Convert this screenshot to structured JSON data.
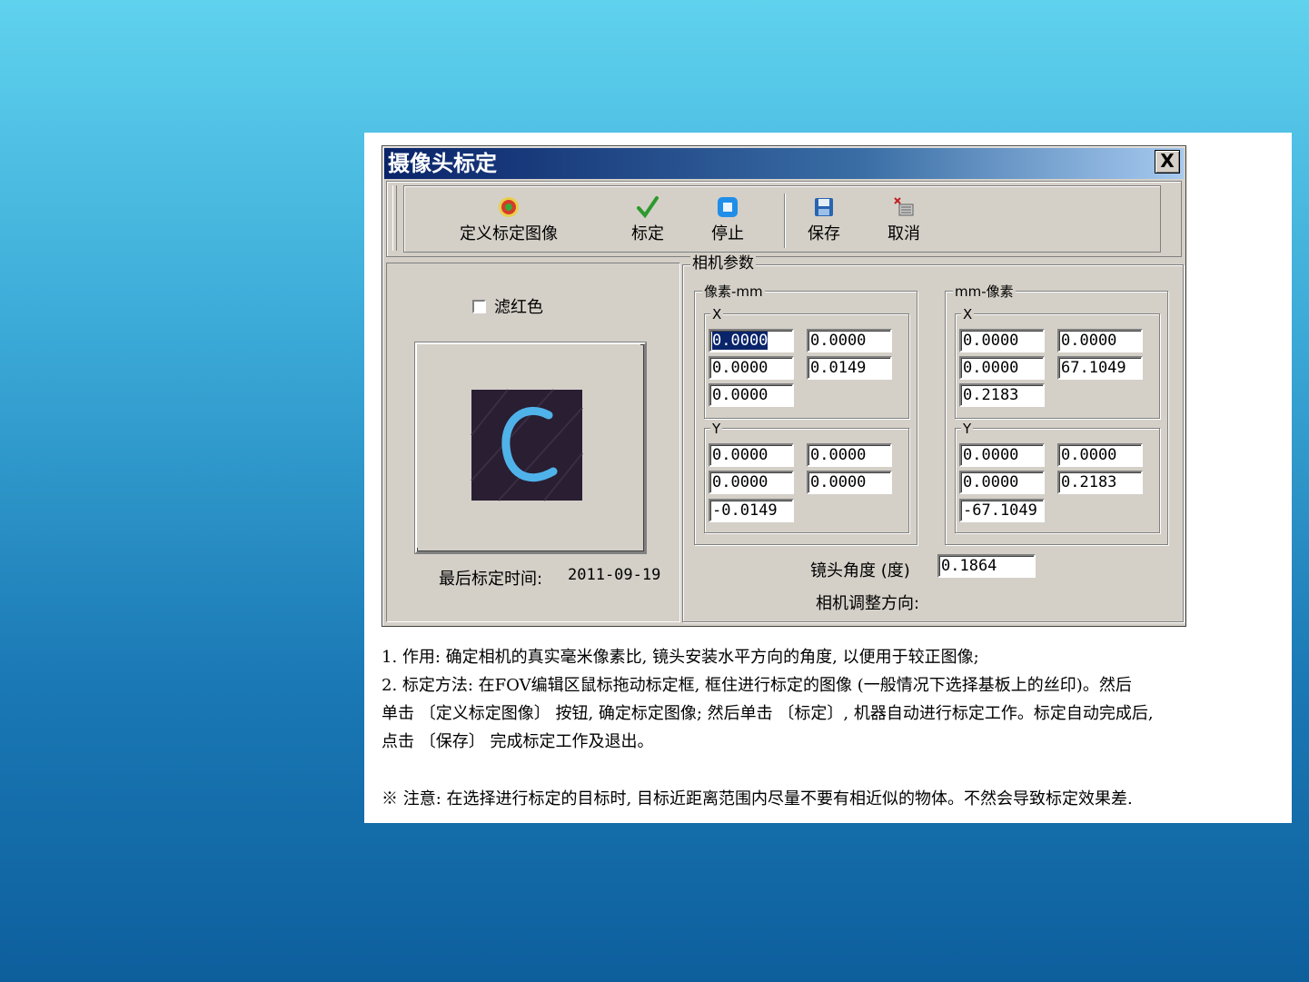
{
  "dialog": {
    "title": "摄像头标定",
    "close_label": "X"
  },
  "toolbar": {
    "define_image": "定义标定图像",
    "calibrate": "标定",
    "stop": "停止",
    "save": "保存",
    "cancel": "取消"
  },
  "left_panel": {
    "filter_red_label": "滤红色",
    "filter_red_checked": false,
    "last_calibration_label": "最后标定时间:",
    "last_calibration_date": "2011-09-19"
  },
  "camera_params": {
    "title": "相机参数",
    "pixel_mm": {
      "title": "像素-mm",
      "x": {
        "label": "X",
        "r1c1": "0.0000",
        "r1c2": "0.0000",
        "r2c1": "0.0000",
        "r2c2": "0.0149",
        "r3c1": "0.0000"
      },
      "y": {
        "label": "Y",
        "r1c1": "0.0000",
        "r1c2": "0.0000",
        "r2c1": "0.0000",
        "r2c2": "0.0000",
        "r3c1": "-0.0149"
      }
    },
    "mm_pixel": {
      "title": "mm-像素",
      "x": {
        "label": "X",
        "r1c1": "0.0000",
        "r1c2": "0.0000",
        "r2c1": "0.0000",
        "r2c2": "67.1049",
        "r3c1": "0.2183"
      },
      "y": {
        "label": "Y",
        "r1c1": "0.0000",
        "r1c2": "0.0000",
        "r2c1": "0.0000",
        "r2c2": "0.2183",
        "r3c1": "-67.1049"
      }
    },
    "lens_angle_label": "镜头角度 (度)",
    "lens_angle_value": "0.1864",
    "adjust_direction_label": "相机调整方向:"
  },
  "description": {
    "line1": "1. 作用: 确定相机的真实毫米像素比, 镜头安装水平方向的角度, 以便用于较正图像;",
    "line2": "2. 标定方法: 在FOV编辑区鼠标拖动标定框, 框住进行标定的图像 (一般情况下选择基板上的丝印)。然后",
    "line3": "单击 〔定义标定图像〕 按钮, 确定标定图像; 然后单击 〔标定〕, 机器自动进行标定工作。标定自动完成后,",
    "line4": "点击 〔保存〕 完成标定工作及退出。",
    "note": "※  注意: 在选择进行标定的目标时, 目标近距离范围内尽量不要有相近似的物体。不然会导致标定效果差."
  },
  "icons": {
    "define_image": "target-icon",
    "calibrate": "checkmark-icon",
    "stop": "stop-icon",
    "save": "floppy-disk-icon",
    "cancel": "cancel-icon"
  },
  "colors": {
    "titlebar_start": "#0a246a",
    "titlebar_end": "#a6caf0",
    "dialog_face": "#d4d0c8",
    "preview_glyph": "#4fb3ea",
    "preview_bg": "#2a1e32"
  }
}
